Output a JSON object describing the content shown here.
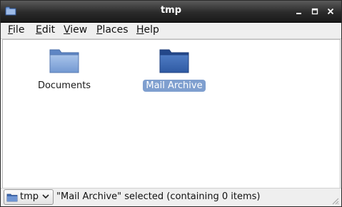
{
  "window": {
    "title": "tmp"
  },
  "title_icons": {
    "app": "folder-icon",
    "minimize": "minimize-icon",
    "maximize": "maximize-icon",
    "close": "close-icon"
  },
  "menu": {
    "items": [
      {
        "label": "File",
        "mnemonic": "F",
        "rest": "ile"
      },
      {
        "label": "Edit",
        "mnemonic": "E",
        "rest": "dit"
      },
      {
        "label": "View",
        "mnemonic": "V",
        "rest": "iew"
      },
      {
        "label": "Places",
        "mnemonic": "P",
        "rest": "laces"
      },
      {
        "label": "Help",
        "mnemonic": "H",
        "rest": "elp"
      }
    ]
  },
  "files": [
    {
      "name": "Documents",
      "selected": false
    },
    {
      "name": "Mail Archive",
      "selected": true
    }
  ],
  "statusbar": {
    "location": "tmp",
    "message": "\"Mail Archive\" selected (containing 0 items)"
  },
  "colors": {
    "selection": "#7f9fcf",
    "folder_light": "#8fb1e0",
    "folder_dark": "#3d67b0"
  }
}
